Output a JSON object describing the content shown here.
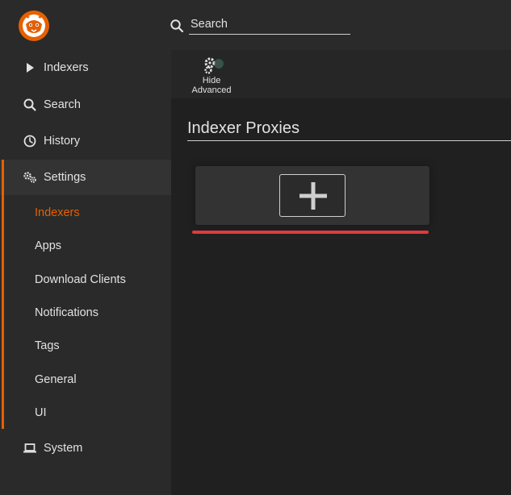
{
  "header": {
    "logo_name": "prowlarr-logo",
    "search": {
      "placeholder": "Search"
    }
  },
  "sidebar": {
    "items": [
      {
        "label": "Indexers",
        "icon": "play-icon"
      },
      {
        "label": "Search",
        "icon": "search-icon"
      },
      {
        "label": "History",
        "icon": "clock-icon"
      },
      {
        "label": "Settings",
        "icon": "cogs-icon"
      },
      {
        "label": "System",
        "icon": "laptop-icon"
      }
    ],
    "settings_subitems": [
      {
        "label": "Indexers",
        "current": true
      },
      {
        "label": "Apps"
      },
      {
        "label": "Download Clients"
      },
      {
        "label": "Notifications"
      },
      {
        "label": "Tags"
      },
      {
        "label": "General"
      },
      {
        "label": "UI"
      }
    ]
  },
  "toolbar": {
    "hide_advanced_line1": "Hide",
    "hide_advanced_line2": "Advanced"
  },
  "main": {
    "title": "Indexer Proxies"
  },
  "colors": {
    "accent": "#e66000",
    "error_underline": "#e0393e",
    "background": "#202020",
    "panel": "#2a2a2a"
  }
}
